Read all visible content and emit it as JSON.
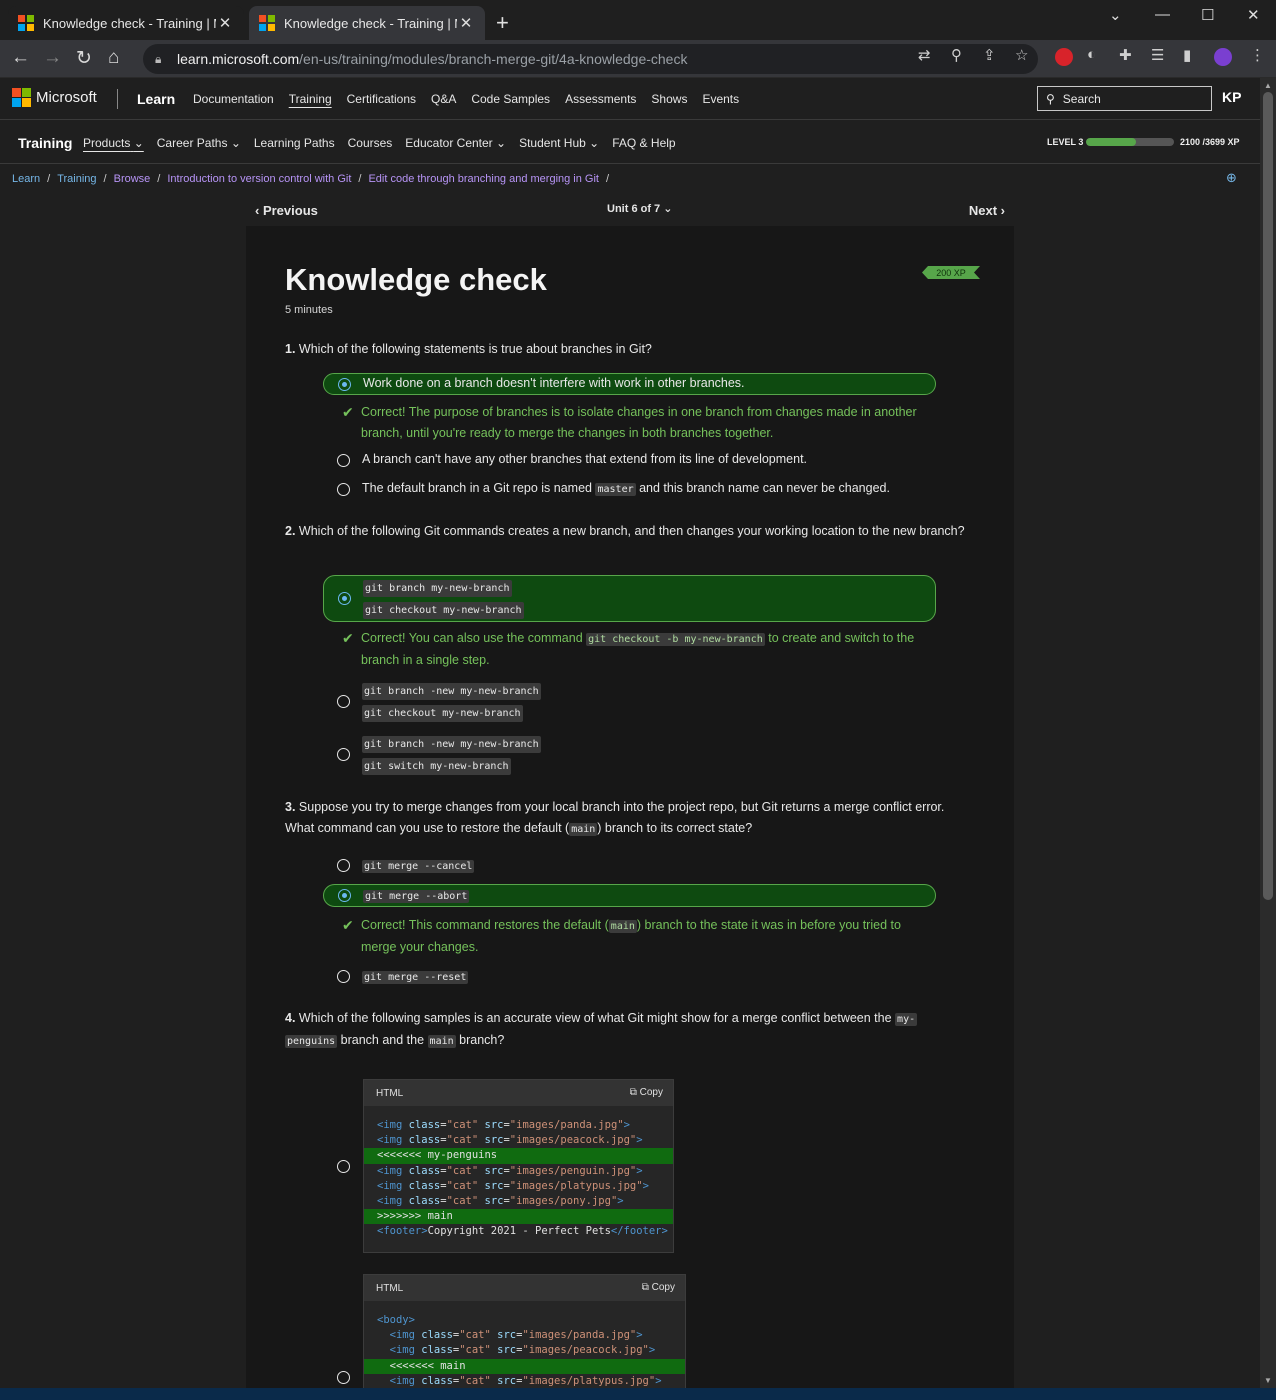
{
  "browser": {
    "tabs": [
      {
        "title": "Knowledge check - Training | Microsoft Learn",
        "active": false
      },
      {
        "title": "Knowledge check - Training | Microsoft Learn",
        "active": true
      }
    ],
    "url_host": "learn.microsoft.com",
    "url_path": "/en-us/training/modules/branch-merge-git/4a-knowledge-check"
  },
  "header": {
    "brand": "Microsoft",
    "product": "Learn",
    "nav": [
      "Documentation",
      "Training",
      "Certifications",
      "Q&A",
      "Code Samples",
      "Assessments",
      "Shows",
      "Events"
    ],
    "search_placeholder": "Search",
    "avatar_initials": "KP"
  },
  "training_bar": {
    "title": "Training",
    "nav": [
      "Products",
      "Career Paths",
      "Learning Paths",
      "Courses",
      "Educator Center",
      "Student Hub",
      "FAQ & Help"
    ],
    "level_label": "LEVEL 3",
    "xp_current": 2100,
    "xp_total": 3699,
    "xp_text": "2100 /3699 XP"
  },
  "breadcrumb": [
    "Learn",
    "Training",
    "Browse",
    "Introduction to version control with Git",
    "Edit code through branching and merging in Git"
  ],
  "unit_nav": {
    "previous": "Previous",
    "unit": "Unit 6 of 7",
    "next": "Next"
  },
  "page": {
    "title": "Knowledge check",
    "duration": "5 minutes",
    "xp_badge": "200 XP"
  },
  "questions": {
    "q1": {
      "num": "1.",
      "text": "Which of the following statements is true about branches in Git?",
      "opt1": "Work done on a branch doesn't interfere with work in other branches.",
      "feedback1": "Correct! The purpose of branches is to isolate changes in one branch from changes made in another branch, until you're ready to merge the changes in both branches together.",
      "opt2": "A branch can't have any other branches that extend from its line of development.",
      "opt3_pre": "The default branch in a Git repo is named",
      "opt3_code": "master",
      "opt3_post": "and this branch name can never be changed."
    },
    "q2": {
      "num": "2.",
      "text": "Which of the following Git commands creates a new branch, and then changes your working location to the new branch?",
      "opt1_line1": "git branch my-new-branch",
      "opt1_line2": "git checkout my-new-branch",
      "feedback_pre": "Correct! You can also use the command",
      "feedback_code": "git checkout -b my-new-branch",
      "feedback_post": "to create and switch to the branch in a single step.",
      "opt2_line1": "git branch -new my-new-branch",
      "opt2_line2": "git checkout my-new-branch",
      "opt3_line1": "git branch -new my-new-branch",
      "opt3_line2": "git switch my-new-branch"
    },
    "q3": {
      "num": "3.",
      "text_pre": "Suppose you try to merge changes from your local branch into the project repo, but Git returns a merge conflict error. What command can you use to restore the default (",
      "text_code": "main",
      "text_post": ") branch to its correct state?",
      "opt1": "git merge --cancel",
      "opt2": "git merge --abort",
      "feedback_pre": "Correct! This command restores the default (",
      "feedback_code": "main",
      "feedback_post": ") branch to the state it was in before you tried to merge your changes.",
      "opt3": "git merge --reset"
    },
    "q4": {
      "num": "4.",
      "text_pre": "Which of the following samples is an accurate view of what Git might show for a merge conflict between the",
      "text_code1a": "my-",
      "text_code1b": "penguins",
      "text_mid": "branch and the",
      "text_code2": "main",
      "text_post": "branch?",
      "code_lang": "HTML",
      "copy_label": "Copy"
    }
  },
  "code_sample_1": [
    {
      "kind": "tag",
      "attrs": [
        [
          "class",
          "\"cat\""
        ],
        [
          "src",
          "\"images/panda.jpg\""
        ]
      ]
    },
    {
      "kind": "tag",
      "attrs": [
        [
          "class",
          "\"cat\""
        ],
        [
          "src",
          "\"images/peacock.jpg\""
        ]
      ]
    },
    {
      "kind": "hl",
      "text": "<<<<<<< my-penguins"
    },
    {
      "kind": "tag",
      "attrs": [
        [
          "class",
          "\"cat\""
        ],
        [
          "src",
          "\"images/penguin.jpg\""
        ]
      ]
    },
    {
      "kind": "tag",
      "attrs": [
        [
          "class",
          "\"cat\""
        ],
        [
          "src",
          "\"images/platypus.jpg\""
        ]
      ]
    },
    {
      "kind": "tag",
      "attrs": [
        [
          "class",
          "\"cat\""
        ],
        [
          "src",
          "\"images/pony.jpg\""
        ]
      ]
    },
    {
      "kind": "hl",
      "text": ">>>>>>> main"
    },
    {
      "kind": "footer",
      "text": "Copyright 2021 - Perfect Pets"
    }
  ],
  "code_sample_2": [
    {
      "kind": "open",
      "text": "<body>"
    },
    {
      "kind": "tag",
      "indent": true,
      "attrs": [
        [
          "class",
          "\"cat\""
        ],
        [
          "src",
          "\"images/panda.jpg\""
        ]
      ]
    },
    {
      "kind": "tag",
      "indent": true,
      "attrs": [
        [
          "class",
          "\"cat\""
        ],
        [
          "src",
          "\"images/peacock.jpg\""
        ]
      ]
    },
    {
      "kind": "hl",
      "indent": true,
      "text": "<<<<<<< main"
    },
    {
      "kind": "tag",
      "indent": true,
      "attrs": [
        [
          "class",
          "\"cat\""
        ],
        [
          "src",
          "\"images/platypus.jpg\""
        ]
      ]
    }
  ],
  "colors": {
    "correct_green": "#57a64a",
    "link_blue": "#75b6e7",
    "visited_purple": "#b794f6",
    "selected_bg": "#0e4a10"
  }
}
